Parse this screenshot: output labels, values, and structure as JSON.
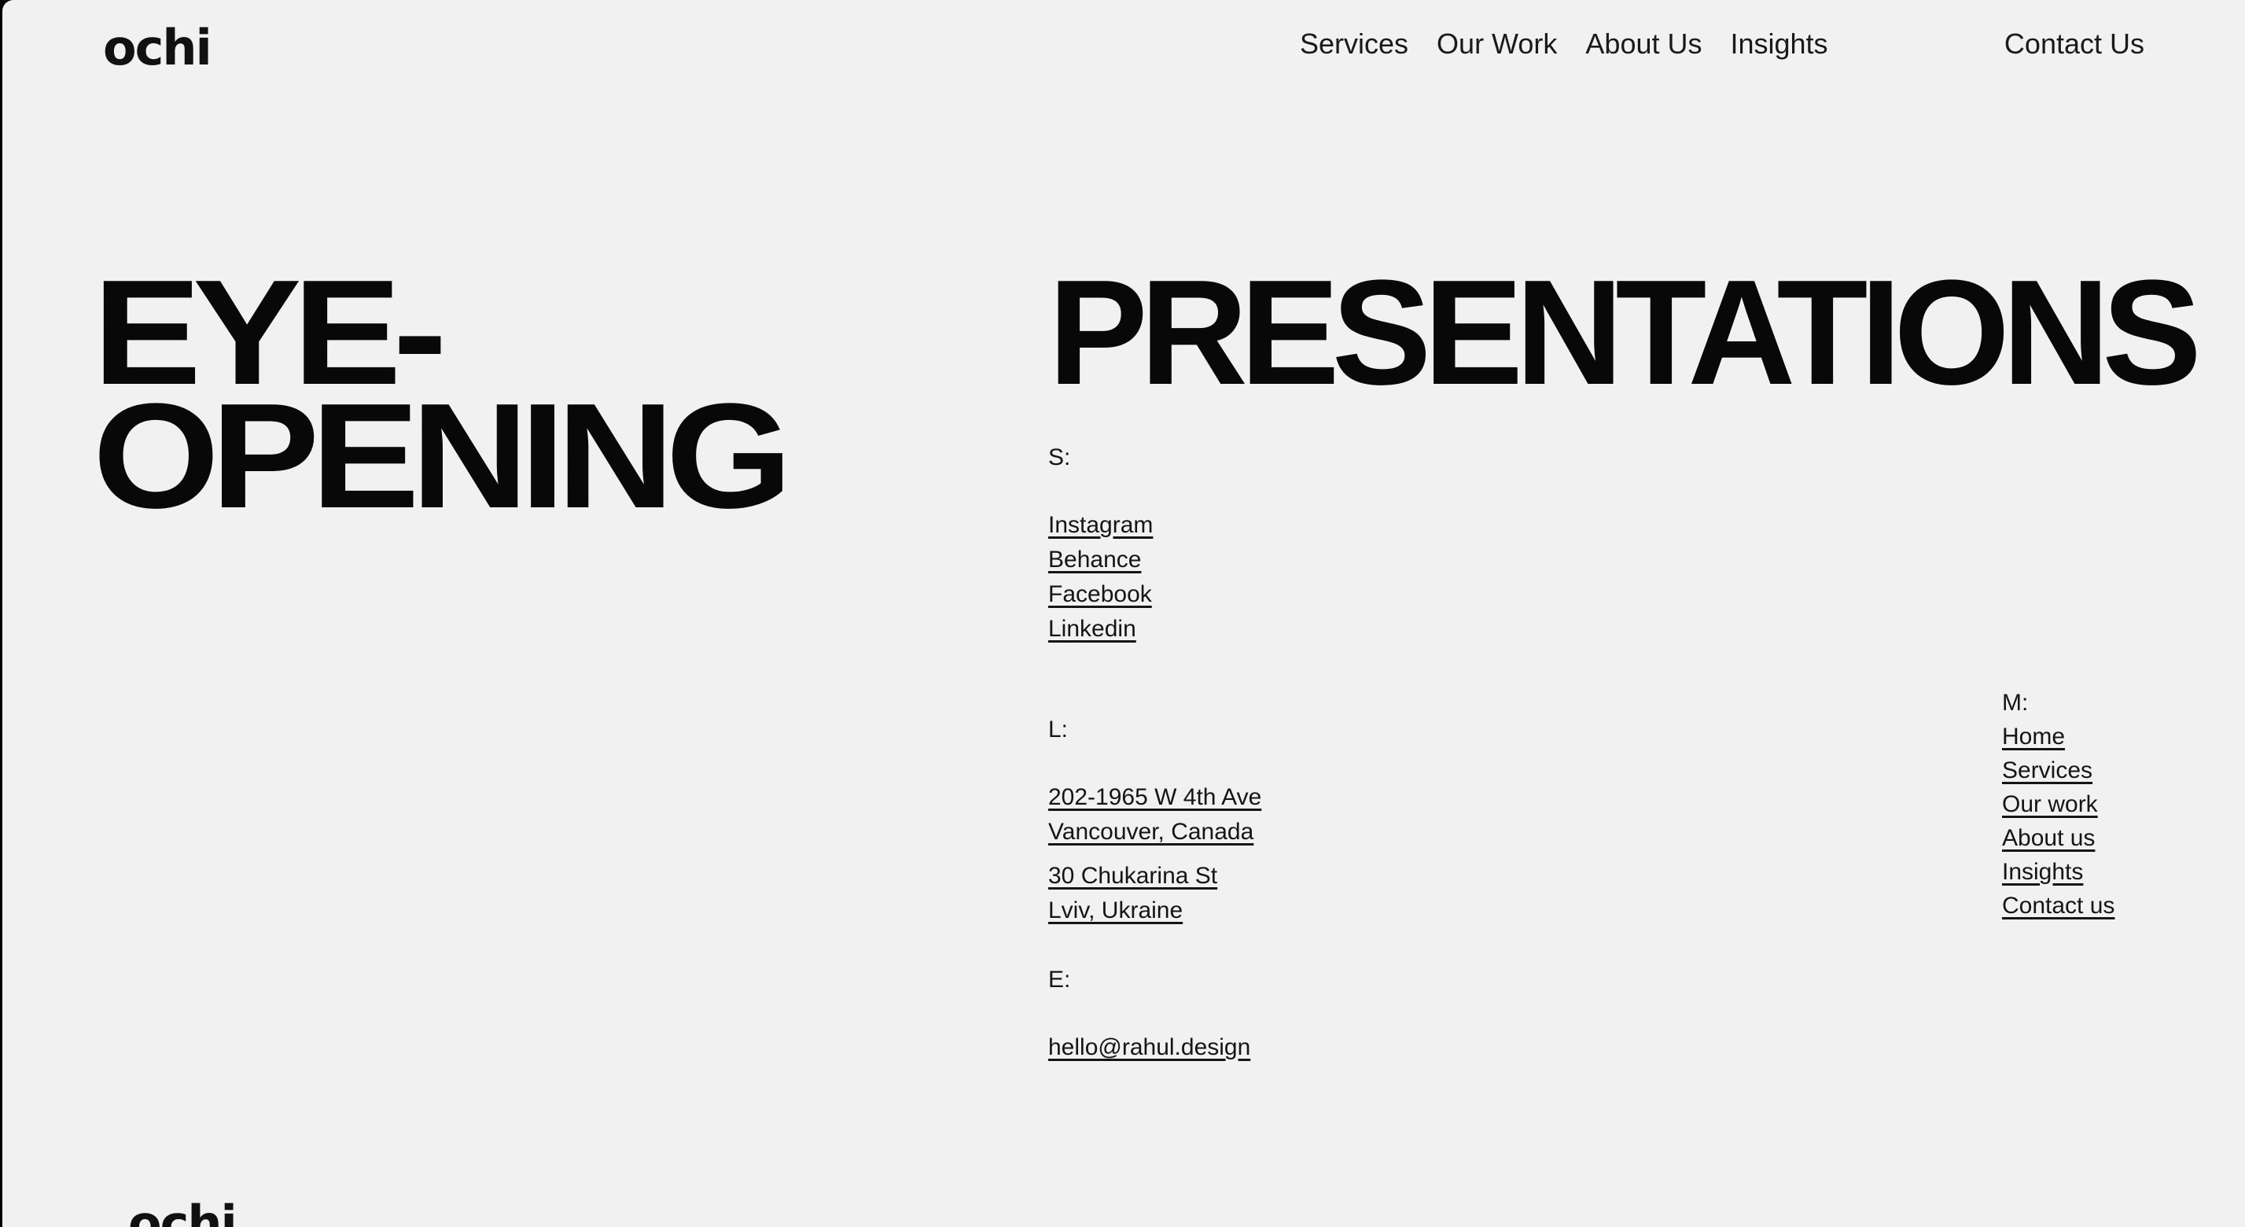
{
  "header": {
    "logo": "ochi",
    "nav": [
      "Services",
      "Our Work",
      "About Us",
      "Insights"
    ],
    "contact": "Contact Us"
  },
  "hero": {
    "left_line1": "EYE-",
    "left_line2": "OPENING",
    "right": "PRESENTATIONS"
  },
  "socials": {
    "label": "S:",
    "items": [
      "Instagram",
      "Behance",
      "Facebook",
      "Linkedin"
    ]
  },
  "locations": {
    "label": "L:",
    "addresses": [
      {
        "line1": "202-1965 W 4th Ave",
        "line2": "Vancouver, Canada"
      },
      {
        "line1": "30 Chukarina St",
        "line2": "Lviv, Ukraine"
      }
    ]
  },
  "email": {
    "label": "E:",
    "address": "hello@rahul.design"
  },
  "menu": {
    "label": "M:",
    "items": [
      "Home",
      "Services",
      "Our work",
      "About us",
      "Insights",
      "Contact us"
    ]
  },
  "footer": {
    "logo": "ochi"
  }
}
